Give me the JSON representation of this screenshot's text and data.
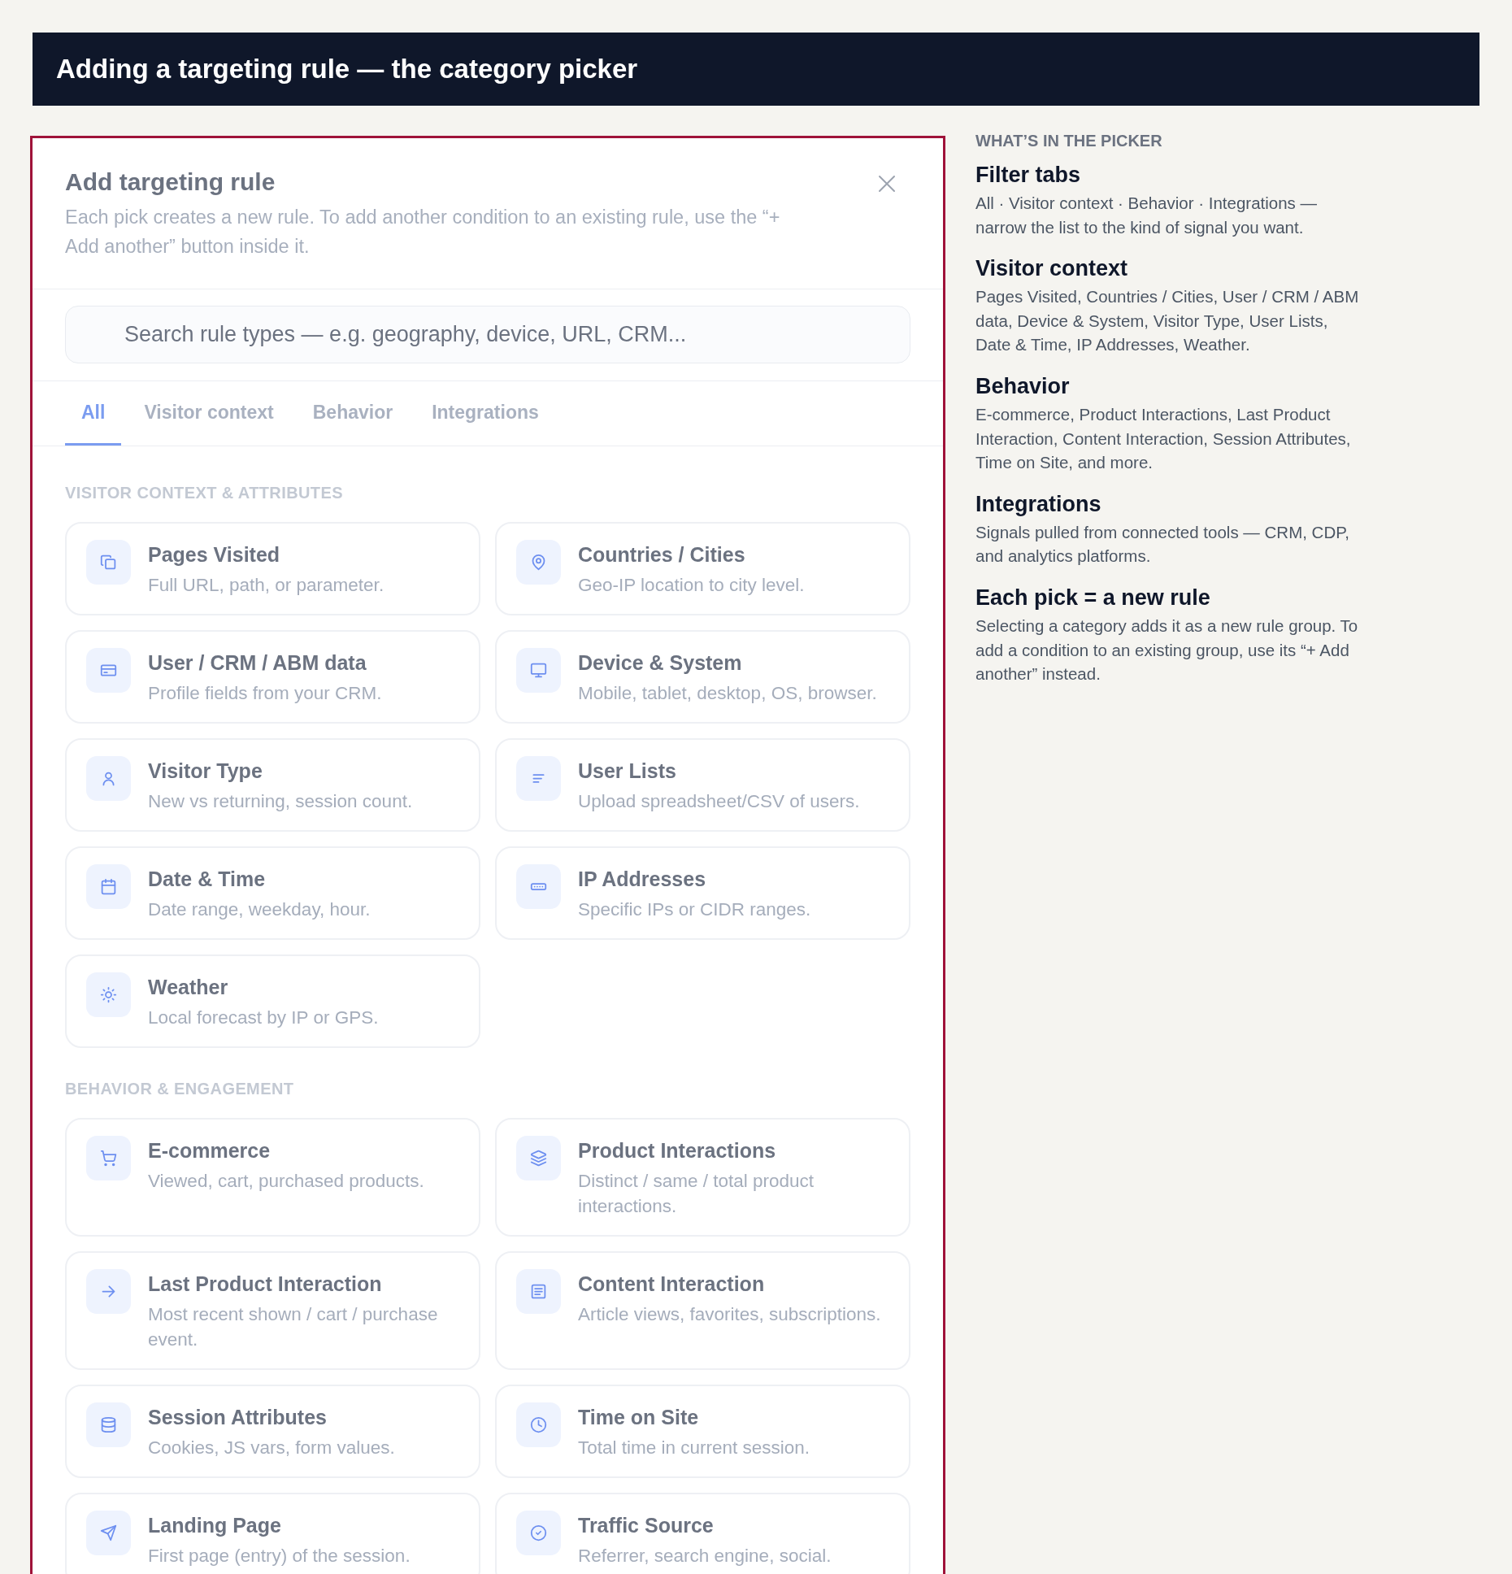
{
  "header": {
    "title": "Adding a targeting rule — the category picker"
  },
  "modal": {
    "title": "Add targeting rule",
    "description": "Each pick creates a new rule. To add another condition to an existing rule, use the “+ Add another” button inside it.",
    "search": {
      "placeholder": "Search rule types — e.g. geography, device, URL, CRM..."
    },
    "tabs": [
      {
        "label": "All",
        "selected": true
      },
      {
        "label": "Visitor context",
        "selected": false
      },
      {
        "label": "Behavior",
        "selected": false
      },
      {
        "label": "Integrations",
        "selected": false
      }
    ],
    "sections": [
      {
        "label": "VISITOR CONTEXT & ATTRIBUTES",
        "items": [
          {
            "title": "Pages Visited",
            "description": "Full URL, path, or parameter."
          },
          {
            "title": "Countries / Cities",
            "description": "Geo-IP location to city level."
          },
          {
            "title": "User / CRM / ABM data",
            "description": "Profile fields from your CRM."
          },
          {
            "title": "Device & System",
            "description": "Mobile, tablet, desktop, OS, browser."
          },
          {
            "title": "Visitor Type",
            "description": "New vs returning, session count."
          },
          {
            "title": "User Lists",
            "description": "Upload spreadsheet/CSV of users."
          },
          {
            "title": "Date & Time",
            "description": "Date range, weekday, hour."
          },
          {
            "title": "IP Addresses",
            "description": "Specific IPs or CIDR ranges."
          },
          {
            "title": "Weather",
            "description": "Local forecast by IP or GPS."
          }
        ]
      },
      {
        "label": "BEHAVIOR & ENGAGEMENT",
        "items": [
          {
            "title": "E-commerce",
            "description": "Viewed, cart, purchased products."
          },
          {
            "title": "Product Interactions",
            "description": "Distinct / same / total product interactions."
          },
          {
            "title": "Last Product Interaction",
            "description": "Most recent shown / cart / purchase event."
          },
          {
            "title": "Content Interaction",
            "description": "Article views, favorites, subscriptions."
          },
          {
            "title": "Session Attributes",
            "description": "Cookies, JS vars, form values."
          },
          {
            "title": "Time on Site",
            "description": "Total time in current session."
          },
          {
            "title": "Landing Page",
            "description": "First page (entry) of the session."
          },
          {
            "title": "Traffic Source",
            "description": "Referrer, search engine, social."
          }
        ]
      }
    ]
  },
  "notes": {
    "eyebrow": "WHAT’S IN THE PICKER",
    "items": [
      {
        "heading": "Filter tabs",
        "text": "All · Visitor context · Behavior · Integrations — narrow the list to the kind of signal you want."
      },
      {
        "heading": "Visitor context",
        "text": "Pages Visited, Countries / Cities, User / CRM / ABM data, Device & System, Visitor Type, User Lists, Date & Time, IP Addresses, Weather."
      },
      {
        "heading": "Behavior",
        "text": "E-commerce, Product Interactions, Last Product Interaction, Content Interaction, Session Attributes, Time on Site, and more."
      },
      {
        "heading": "Integrations",
        "text": "Signals pulled from connected tools — CRM, CDP, and analytics platforms."
      },
      {
        "heading": "Each pick = a new rule",
        "text": "Selecting a category adds it as a new rule group. To add a condition to an existing group, use its “+ Add another” instead."
      }
    ]
  }
}
